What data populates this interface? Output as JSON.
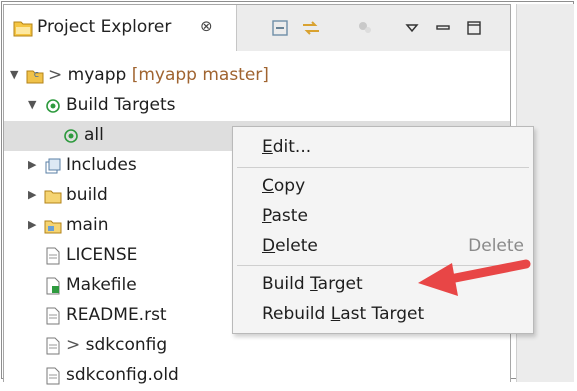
{
  "panel": {
    "title": "Project Explorer",
    "close_glyph": "⊗",
    "toolbar": [
      {
        "icon": "collapse-all-icon"
      },
      {
        "icon": "link-with-editor-icon"
      },
      {
        "icon": "filter-icon"
      },
      {
        "icon": "view-menu-icon"
      },
      {
        "icon": "minimize-icon"
      },
      {
        "icon": "maximize-icon"
      }
    ]
  },
  "tree": {
    "project": {
      "prefix": "> ",
      "name": "myapp",
      "git": "[myapp master]"
    },
    "build_targets": "Build Targets",
    "target_all": "all",
    "includes": "Includes",
    "build": "build",
    "main": "main",
    "license": "LICENSE",
    "makefile": "Makefile",
    "readme": "README.rst",
    "sdkconfig": {
      "prefix": "> ",
      "name": "sdkconfig"
    },
    "sdkconfig_old": "sdkconfig.old"
  },
  "menu": {
    "edit": {
      "first": "E",
      "rest": "dit..."
    },
    "copy": {
      "first": "C",
      "rest": "opy"
    },
    "paste": {
      "first": "P",
      "rest": "aste"
    },
    "delete": {
      "first": "D",
      "rest": "elete",
      "shortcut": "Delete"
    },
    "build_target": {
      "pre": "Build ",
      "u": "T",
      "post": "arget"
    },
    "rebuild": {
      "pre": "Rebuild ",
      "u": "L",
      "post": "ast Target"
    }
  },
  "colors": {
    "annotation_arrow": "#e84646",
    "selection": "#dedede"
  }
}
